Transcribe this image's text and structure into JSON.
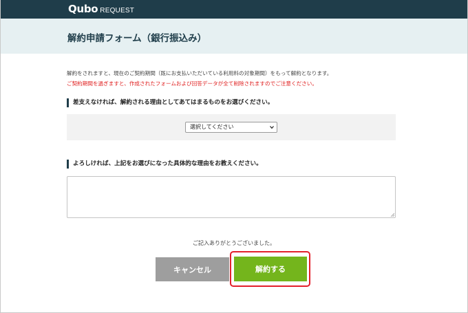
{
  "header": {
    "logo_main": "Qubo",
    "logo_sub": "REQUEST",
    "bg_color": "#1f3d4a"
  },
  "page": {
    "title": "解約申請フォーム（銀行振込み）"
  },
  "notices": {
    "line1": "解約をされますと、現在のご契約期間（既にお支払いただいている利用料の対象期間）をもって解約となります。",
    "line2": "ご契約期間を過ぎますと、作成されたフォームおよび回答データが全て削除されますのでご注意ください。",
    "warning_color": "#e02020"
  },
  "question1": {
    "heading": "差支えなければ、解約される理由としてあてはまるものをお選びください。",
    "select_value": "選択してください",
    "icon": "chevron-down-icon"
  },
  "question2": {
    "heading": "よろしければ、上記をお選びになった具体的な理由をお教えください。",
    "textarea_value": ""
  },
  "footer": {
    "thanks": "ご記入ありがとうございました。",
    "cancel_label": "キャンセル",
    "submit_label": "解約する",
    "submit_color": "#74b51c",
    "cancel_color": "#9e9e9e",
    "highlight_color": "#e31f2a"
  }
}
